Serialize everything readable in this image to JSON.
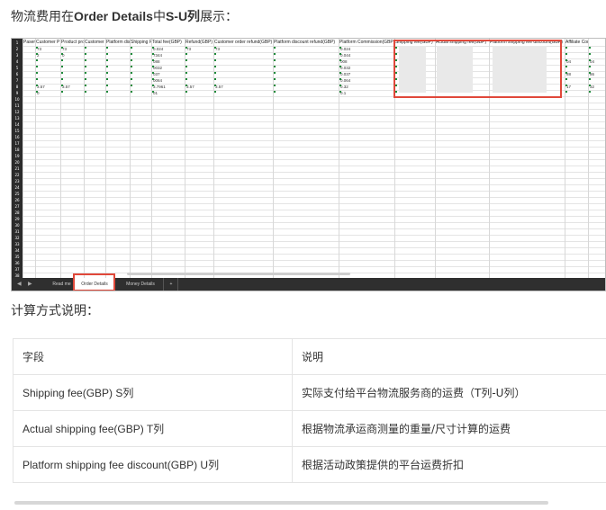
{
  "heading": {
    "prefix": "物流费用在",
    "sheet_name": "Order Details",
    "middle": "中",
    "columns": "S-U列",
    "suffix": "展示："
  },
  "heading2": "计算方式说明：",
  "sheet": {
    "column_headers": [
      "Pasemir",
      "Customer P",
      "Product pro",
      "Customer d",
      "Platform dis",
      "Shipping Fa",
      "Total fee(GBP)",
      "Refund(GBP)",
      "Customer order refund(GBP)",
      "Platform discount refund(GBP)",
      "Platform Commission(GBP)",
      "Shipping fee(GBP)",
      "Actual shipping fee(GBP)",
      "Platform shipping fee discount(GBP)",
      "Affiliate Commission(GBP)"
    ],
    "row_numbers": [
      "1",
      "2",
      "3",
      "4",
      "5",
      "6",
      "7",
      "8",
      "9",
      "10",
      "11",
      "12",
      "13",
      "14",
      "15",
      "16",
      "17",
      "18",
      "19",
      "20",
      "21",
      "22",
      "23",
      "24",
      "25",
      "26",
      "27",
      "28",
      "29",
      "30",
      "31",
      "32",
      "33",
      "34",
      "35",
      "36",
      "37",
      "38"
    ],
    "col_b_values": [
      "",
      "73",
      "2",
      "",
      "",
      "",
      "",
      "3.57",
      "0"
    ],
    "col_c_values": [
      "",
      "73",
      "0",
      "",
      "",
      "",
      "",
      "3.57",
      ""
    ],
    "col_g_values": [
      "",
      "0.024",
      "7344",
      "088",
      "0032",
      "037",
      "0064",
      "3.7961",
      "01"
    ],
    "col_h_values": [
      "",
      "73",
      "",
      "",
      "",
      "",
      "",
      "3.57",
      ""
    ],
    "col_i_values": [
      "",
      "73",
      "",
      "",
      "",
      "",
      "",
      "3.57",
      ""
    ],
    "col_k_values": [
      "",
      "0.024",
      "0.044",
      "008",
      "0.032",
      "0.037",
      "0.064",
      "0.32",
      "0.1"
    ],
    "col_o_values": [
      "",
      "",
      "",
      "04",
      "",
      "88",
      "",
      "17",
      ""
    ],
    "col_p_values": [
      "",
      "",
      "",
      "04",
      "",
      "86",
      "",
      "32",
      ""
    ],
    "tabs": [
      "Read me",
      "Order Details",
      "Money Details"
    ],
    "add_tab": "+",
    "nav_prev": "◀",
    "nav_next": "▶"
  },
  "table": {
    "header": [
      "字段",
      "说明"
    ],
    "rows": [
      {
        "field": "Shipping fee(GBP) S列",
        "desc": "实际支付给平台物流服务商的运费（T列-U列）"
      },
      {
        "field": "Actual shipping fee(GBP) T列",
        "desc": "根据物流承运商测量的重量/尺寸计算的运费"
      },
      {
        "field": "Platform shipping fee discount(GBP) U列",
        "desc": "根据活动政策提供的平台运费折扣"
      }
    ]
  }
}
